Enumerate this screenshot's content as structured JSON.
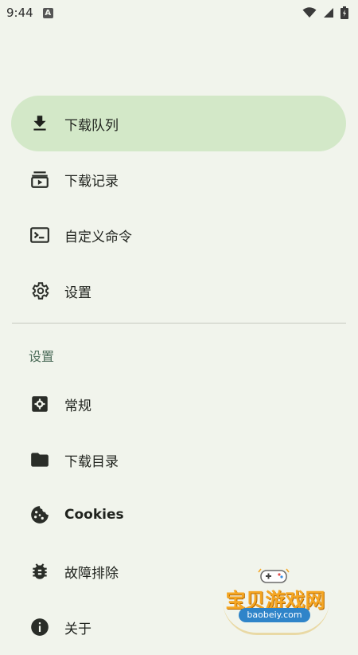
{
  "status_bar": {
    "time": "9:44",
    "notification_glyph": "A",
    "icons": [
      "wifi-icon",
      "signal-icon",
      "battery-charging-icon"
    ]
  },
  "nav": {
    "items": [
      {
        "label": "下载队列",
        "icon": "download-icon",
        "active": true
      },
      {
        "label": "下载记录",
        "icon": "download-history-icon",
        "active": false
      },
      {
        "label": "自定义命令",
        "icon": "terminal-icon",
        "active": false
      },
      {
        "label": "设置",
        "icon": "gear-icon",
        "active": false
      }
    ]
  },
  "settings_section": {
    "header": "设置",
    "items": [
      {
        "label": "常规",
        "icon": "general-settings-icon"
      },
      {
        "label": "下载目录",
        "icon": "folder-icon"
      },
      {
        "label": "Cookies",
        "icon": "cookie-icon"
      },
      {
        "label": "故障排除",
        "icon": "bug-icon"
      },
      {
        "label": "关于",
        "icon": "info-icon"
      }
    ]
  },
  "watermark": {
    "text": "宝贝游戏网",
    "url": "baobeiy.com"
  },
  "colors": {
    "background": "#f1f4ec",
    "active_item_bg": "#d3e8c8",
    "section_header": "#4d6d5a",
    "divider": "#c6c9c0",
    "icon": "#2a2d28"
  }
}
